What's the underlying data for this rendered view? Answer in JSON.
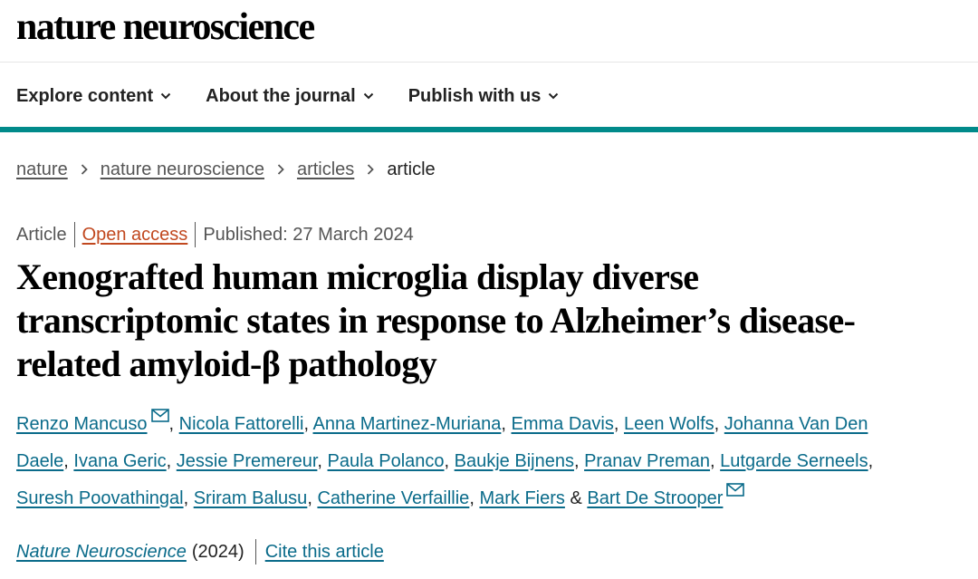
{
  "header": {
    "brand": "nature neuroscience"
  },
  "nav": {
    "items": [
      {
        "label": "Explore content"
      },
      {
        "label": "About the journal"
      },
      {
        "label": "Publish with us"
      }
    ]
  },
  "breadcrumb": {
    "items": [
      "nature",
      "nature neuroscience",
      "articles"
    ],
    "current": "article"
  },
  "article": {
    "type": "Article",
    "access": "Open access",
    "published": "Published: 27 March 2024",
    "title": "Xenografted human microglia display diverse transcriptomic states in response to Alzheimer’s disease-related amyloid-β pathology",
    "authors": [
      "Renzo Mancuso",
      "Nicola Fattorelli",
      "Anna Martinez-Muriana",
      "Emma Davis",
      "Leen Wolfs",
      "Johanna Van Den Daele",
      "Ivana Geric",
      "Jessie Premereur",
      "Paula Polanco",
      "Baukje Bijnens",
      "Pranav Preman",
      "Lutgarde Serneels",
      "Suresh Poovathingal",
      "Sriram Balusu",
      "Catherine Verfaillie",
      "Mark Fiers",
      "Bart De Strooper"
    ],
    "authors_conjunction": "&",
    "journal": "Nature Neuroscience",
    "year": "(2024)",
    "cite_label": "Cite this article"
  },
  "icons": {
    "chevron": "chevron-down-icon",
    "separator": "chevron-right-icon",
    "mail": "mail-icon"
  },
  "colors": {
    "accent_bar": "#008a8a",
    "link": "#0a6b8a",
    "open_access": "#c1481f"
  }
}
